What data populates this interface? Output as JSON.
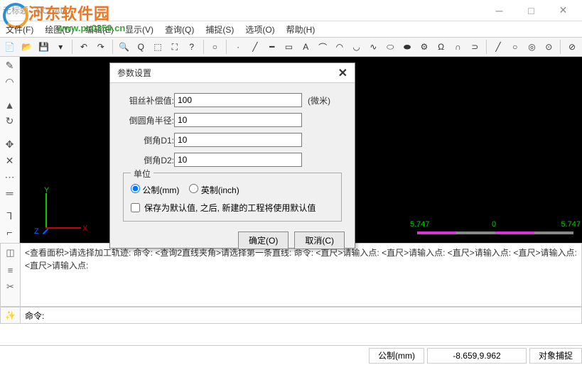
{
  "window": {
    "title": "无标题 - NCCAD",
    "watermark": "河东软件园",
    "watermark_url": "www.pc0359.cn"
  },
  "menu": {
    "file": "文件(F)",
    "draw": "绘图(D)",
    "edit": "编辑(E)",
    "display": "显示(V)",
    "query": "查询(Q)",
    "snap": "捕捉(S)",
    "option": "选项(O)",
    "help": "帮助(H)"
  },
  "axis": {
    "x": "X",
    "y": "Y",
    "z": "Z"
  },
  "ruler": {
    "left": "5.747",
    "mid": "0",
    "right": "5.747"
  },
  "command_log": "<查看面积>请选择加工轨迹: 命令: <查询2直线夹角>请选择第一条直线: 命令: <直尺>请输入点: <直尺>请输入点: <直尺>请输入点: <直尺>请输入点: <直尺>请输入点:",
  "command_prompt": "命令:",
  "status": {
    "mode": "公制(mm)",
    "coords": "-8.659,9.962",
    "snap": "对象捕捉"
  },
  "dialog": {
    "title": "参数设置",
    "fields": {
      "comp_label": "钼丝补偿值:",
      "comp_value": "100",
      "comp_unit": "(微米)",
      "fillet_label": "倒圆角半径:",
      "fillet_value": "10",
      "d1_label": "倒角D1:",
      "d1_value": "10",
      "d2_label": "倒角D2:",
      "d2_value": "10"
    },
    "unit_group": {
      "legend": "单位",
      "metric": "公制(mm)",
      "imperial": "英制(inch)",
      "save_default": "保存为默认值, 之后, 新建的工程将使用默认值"
    },
    "ok": "确定(O)",
    "cancel": "取消(C)"
  }
}
